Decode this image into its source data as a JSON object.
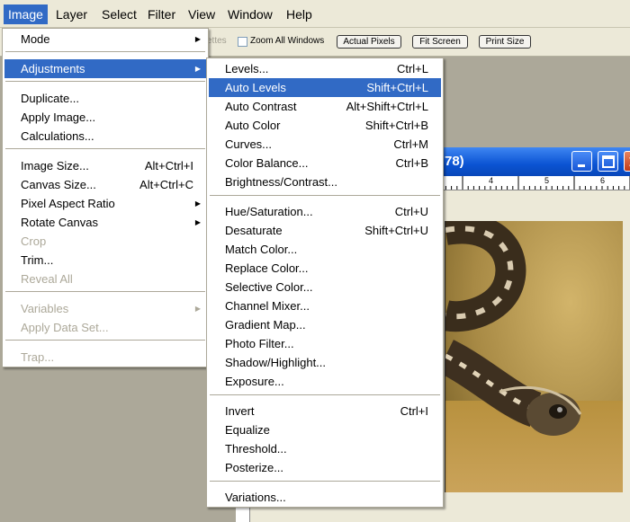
{
  "menubar": {
    "items": [
      "Image",
      "Layer",
      "Select",
      "Filter",
      "View",
      "Window",
      "Help"
    ]
  },
  "options_bar": {
    "palettes_fragment": "ettes",
    "zoom_all_windows": "Zoom All Windows",
    "actual_pixels": "Actual Pixels",
    "fit_screen": "Fit Screen",
    "print_size": "Print Size"
  },
  "document": {
    "title_fragment": "78)",
    "ruler_labels": [
      "4",
      "5",
      "6"
    ]
  },
  "image_menu": {
    "items": [
      {
        "label": "Mode",
        "shortcut": "",
        "submenu": true,
        "state": "normal"
      },
      {
        "label": "Adjustments",
        "shortcut": "",
        "submenu": true,
        "state": "highlighted"
      },
      {
        "label": "Duplicate...",
        "shortcut": "",
        "submenu": false,
        "state": "normal"
      },
      {
        "label": "Apply Image...",
        "shortcut": "",
        "submenu": false,
        "state": "normal"
      },
      {
        "label": "Calculations...",
        "shortcut": "",
        "submenu": false,
        "state": "normal"
      },
      {
        "label": "Image Size...",
        "shortcut": "Alt+Ctrl+I",
        "submenu": false,
        "state": "normal"
      },
      {
        "label": "Canvas Size...",
        "shortcut": "Alt+Ctrl+C",
        "submenu": false,
        "state": "normal"
      },
      {
        "label": "Pixel Aspect Ratio",
        "shortcut": "",
        "submenu": true,
        "state": "normal"
      },
      {
        "label": "Rotate Canvas",
        "shortcut": "",
        "submenu": true,
        "state": "normal"
      },
      {
        "label": "Crop",
        "shortcut": "",
        "submenu": false,
        "state": "disabled"
      },
      {
        "label": "Trim...",
        "shortcut": "",
        "submenu": false,
        "state": "normal"
      },
      {
        "label": "Reveal All",
        "shortcut": "",
        "submenu": false,
        "state": "disabled"
      },
      {
        "label": "Variables",
        "shortcut": "",
        "submenu": true,
        "state": "disabled"
      },
      {
        "label": "Apply Data Set...",
        "shortcut": "",
        "submenu": false,
        "state": "disabled"
      },
      {
        "label": "Trap...",
        "shortcut": "",
        "submenu": false,
        "state": "disabled"
      }
    ]
  },
  "adjustments_menu": {
    "items": [
      {
        "label": "Levels...",
        "shortcut": "Ctrl+L",
        "state": "normal"
      },
      {
        "label": "Auto Levels",
        "shortcut": "Shift+Ctrl+L",
        "state": "highlighted"
      },
      {
        "label": "Auto Contrast",
        "shortcut": "Alt+Shift+Ctrl+L",
        "state": "normal"
      },
      {
        "label": "Auto Color",
        "shortcut": "Shift+Ctrl+B",
        "state": "normal"
      },
      {
        "label": "Curves...",
        "shortcut": "Ctrl+M",
        "state": "normal"
      },
      {
        "label": "Color Balance...",
        "shortcut": "Ctrl+B",
        "state": "normal"
      },
      {
        "label": "Brightness/Contrast...",
        "shortcut": "",
        "state": "normal"
      },
      {
        "label": "Hue/Saturation...",
        "shortcut": "Ctrl+U",
        "state": "normal"
      },
      {
        "label": "Desaturate",
        "shortcut": "Shift+Ctrl+U",
        "state": "normal"
      },
      {
        "label": "Match Color...",
        "shortcut": "",
        "state": "normal"
      },
      {
        "label": "Replace Color...",
        "shortcut": "",
        "state": "normal"
      },
      {
        "label": "Selective Color...",
        "shortcut": "",
        "state": "normal"
      },
      {
        "label": "Channel Mixer...",
        "shortcut": "",
        "state": "normal"
      },
      {
        "label": "Gradient Map...",
        "shortcut": "",
        "state": "normal"
      },
      {
        "label": "Photo Filter...",
        "shortcut": "",
        "state": "normal"
      },
      {
        "label": "Shadow/Highlight...",
        "shortcut": "",
        "state": "normal"
      },
      {
        "label": "Exposure...",
        "shortcut": "",
        "state": "normal"
      },
      {
        "label": "Invert",
        "shortcut": "Ctrl+I",
        "state": "normal"
      },
      {
        "label": "Equalize",
        "shortcut": "",
        "state": "normal"
      },
      {
        "label": "Threshold...",
        "shortcut": "",
        "state": "normal"
      },
      {
        "label": "Posterize...",
        "shortcut": "",
        "state": "normal"
      },
      {
        "label": "Variations...",
        "shortcut": "",
        "state": "normal"
      }
    ]
  },
  "colors": {
    "highlight": "#316ac5",
    "menu_background": "#ffffff",
    "disabled_text": "#aca899",
    "chrome": "#ece9d8",
    "titlebar": "#0a53d3"
  }
}
